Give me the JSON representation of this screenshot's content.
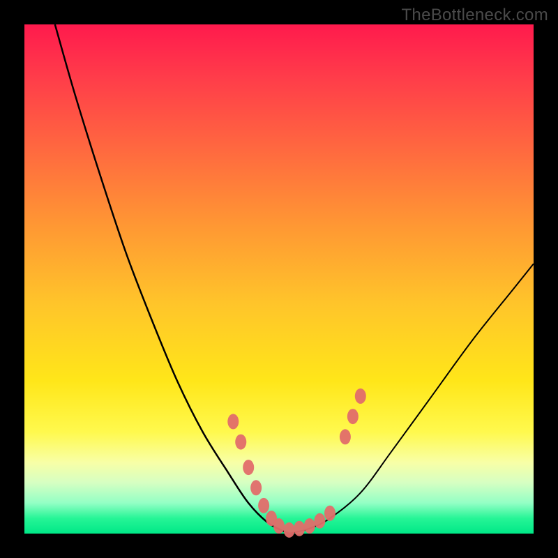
{
  "watermark": "TheBottleneck.com",
  "colors": {
    "curve": "#000000",
    "marker_fill": "#e26d6a",
    "marker_stroke": "#c74a47",
    "background_top": "#ff1a4d",
    "background_bottom": "#00e887"
  },
  "chart_data": {
    "type": "line",
    "title": "",
    "xlabel": "",
    "ylabel": "",
    "xlim": [
      0,
      100
    ],
    "ylim": [
      0,
      100
    ],
    "grid": false,
    "note": "No axes or tick labels rendered; curve values are visual estimates against a 0–100 normalized box (y=0 bottom, y=100 top).",
    "series": [
      {
        "name": "left-branch",
        "x": [
          6,
          10,
          15,
          20,
          25,
          30,
          35,
          40,
          44,
          48,
          52
        ],
        "y": [
          100,
          86,
          70,
          55,
          42,
          30,
          20,
          12,
          6,
          2,
          0
        ]
      },
      {
        "name": "right-branch",
        "x": [
          52,
          56,
          60,
          66,
          72,
          80,
          88,
          96,
          100
        ],
        "y": [
          0,
          1,
          3,
          8,
          16,
          27,
          38,
          48,
          53
        ]
      }
    ],
    "markers": {
      "name": "valley-dots",
      "points": [
        {
          "x": 41,
          "y": 22
        },
        {
          "x": 42.5,
          "y": 18
        },
        {
          "x": 44,
          "y": 13
        },
        {
          "x": 45.5,
          "y": 9
        },
        {
          "x": 47,
          "y": 5.5
        },
        {
          "x": 48.5,
          "y": 3
        },
        {
          "x": 50,
          "y": 1.5
        },
        {
          "x": 52,
          "y": 0.7
        },
        {
          "x": 54,
          "y": 1
        },
        {
          "x": 56,
          "y": 1.5
        },
        {
          "x": 58,
          "y": 2.5
        },
        {
          "x": 60,
          "y": 4
        },
        {
          "x": 63,
          "y": 19
        },
        {
          "x": 64.5,
          "y": 23
        },
        {
          "x": 66,
          "y": 27
        }
      ]
    }
  }
}
